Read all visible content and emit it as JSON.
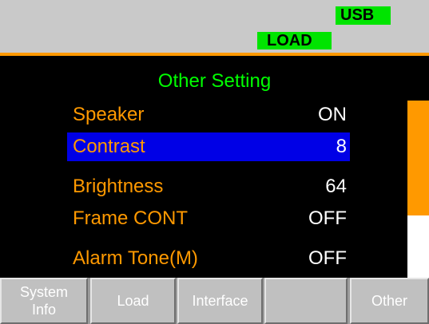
{
  "status": {
    "usb_badge": "USB",
    "load_badge": "LOAD"
  },
  "panel": {
    "title": "Other Setting",
    "items": [
      {
        "label": "Speaker",
        "value": "ON"
      },
      {
        "label": "Contrast",
        "value": "8"
      },
      {
        "label": "Brightness",
        "value": "64"
      },
      {
        "label": "Frame CONT",
        "value": "OFF"
      },
      {
        "label": "Alarm Tone(M)",
        "value": "OFF"
      }
    ],
    "selected_index": 1,
    "scroll_position_fraction": 0.65
  },
  "softkeys": [
    {
      "label_line1": "System",
      "label_line2": "Info"
    },
    {
      "label_line1": "Load",
      "label_line2": ""
    },
    {
      "label_line1": "Interface",
      "label_line2": ""
    },
    {
      "label_line1": "",
      "label_line2": ""
    },
    {
      "label_line1": "Other",
      "label_line2": ""
    }
  ],
  "colors": {
    "badge_green": "#00e400",
    "label_orange": "#ff9900",
    "title_green": "#00ff00",
    "selection_blue": "#0000e6",
    "screen_black": "#000000"
  }
}
